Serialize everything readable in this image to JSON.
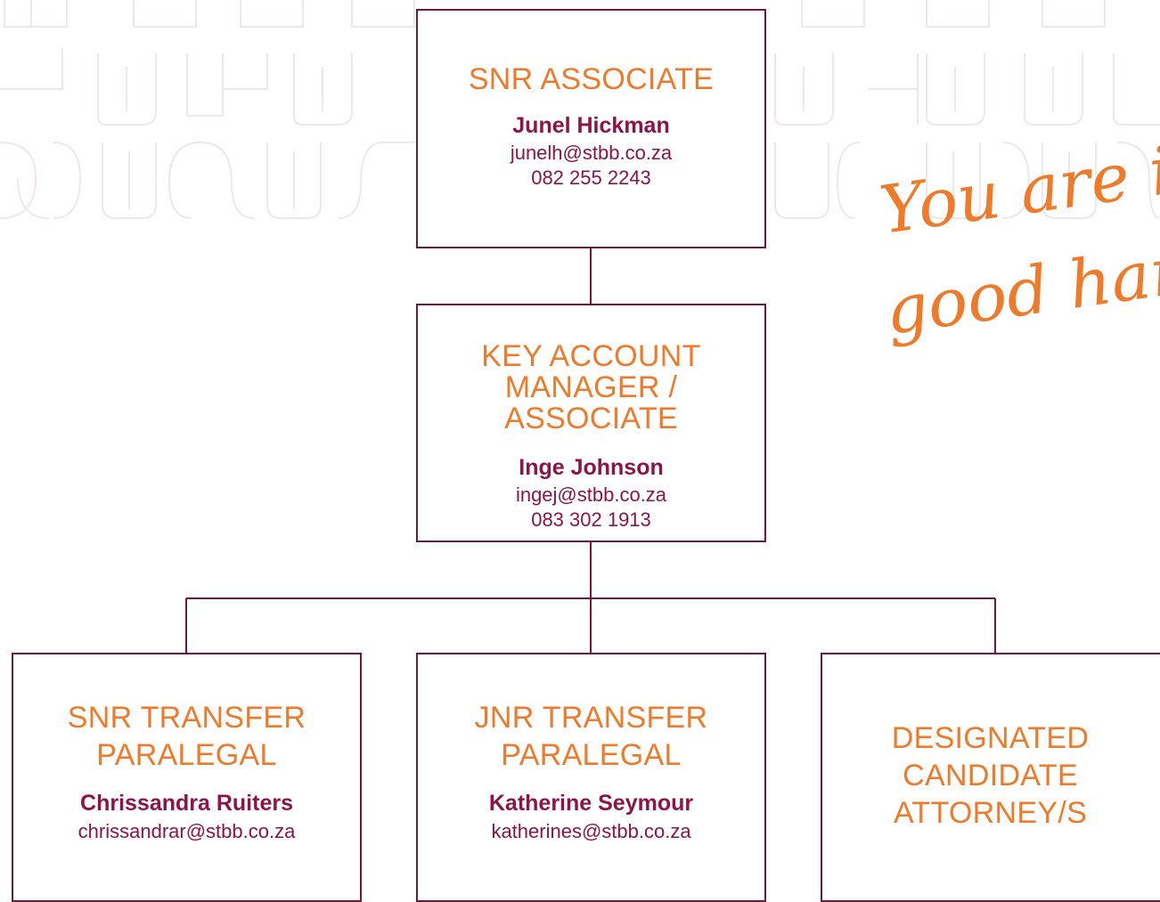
{
  "colors": {
    "border": "#6d1a3b",
    "role_text": "#ee7a2a",
    "name_text": "#8e1446",
    "pattern": "#efe7ea"
  },
  "tagline": {
    "line1": "You are in",
    "line2": "good hands"
  },
  "nodes": {
    "snr_associate": {
      "role": "SNR ASSOCIATE",
      "name": "Junel Hickman",
      "email": "junelh@stbb.co.za",
      "phone": "082 255 2243"
    },
    "key_account": {
      "role": "KEY ACCOUNT\nMANAGER / ASSOCIATE",
      "name": "Inge Johnson",
      "email": "ingej@stbb.co.za",
      "phone": "083 302 1913"
    },
    "snr_paralegal": {
      "role": "SNR TRANSFER\nPARALEGAL",
      "name": "Chrissandra Ruiters",
      "email": "chrissandrar@stbb.co.za"
    },
    "jnr_paralegal": {
      "role": "JNR TRANSFER\nPARALEGAL",
      "name": "Katherine Seymour",
      "email": "katherines@stbb.co.za"
    },
    "candidate": {
      "role": "DESIGNATED\nCANDIDATE\nATTORNEY/S"
    }
  }
}
